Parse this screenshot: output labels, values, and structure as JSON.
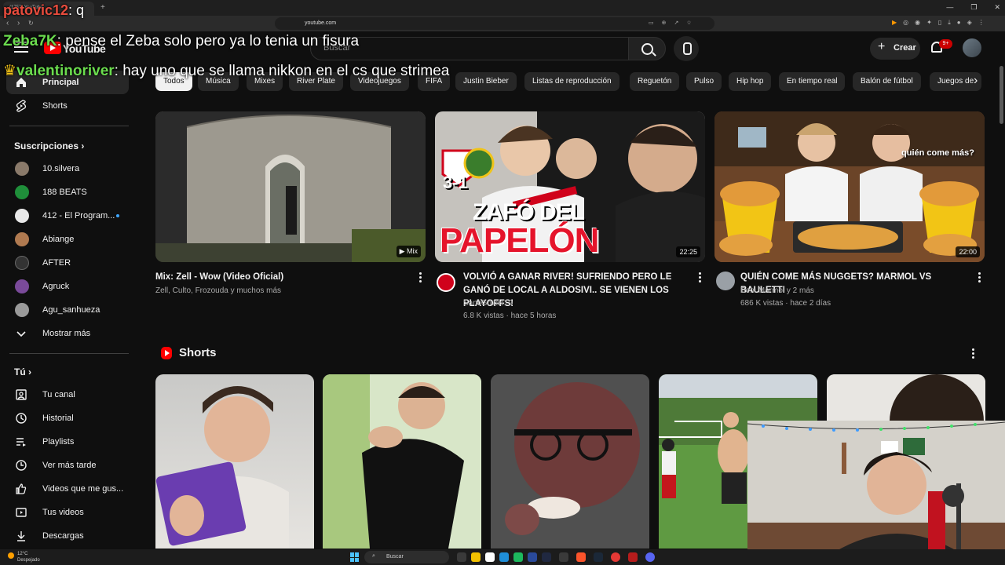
{
  "browser": {
    "tab_title": "(1757) YouTube",
    "new_tab": "+",
    "address": "youtube.com",
    "win_controls": [
      "—",
      "❐",
      "✕"
    ]
  },
  "yt": {
    "wordmark": "YouTube",
    "search_placeholder": "Buscar",
    "create_label": "Crear",
    "notif_count": "9+"
  },
  "chat": [
    {
      "user": "patovic12",
      "text": ": q",
      "color": "#e84c3d"
    },
    {
      "user": "Zeba7K",
      "text": ": pense el Zeba solo pero ya lo tenia un fisura",
      "color": "#6bdc4e"
    },
    {
      "user": "valentinoriver",
      "text": ": hay uno que se llama nikkon en el cs que strimea",
      "color": "#6bdc4e"
    }
  ],
  "sidebar": {
    "main": [
      {
        "label": "Principal",
        "icon": "home-icon",
        "active": true
      },
      {
        "label": "Shorts",
        "icon": "shorts-icon",
        "active": false
      }
    ],
    "subs_header": "Suscripciones",
    "subs": [
      {
        "label": "10.silvera",
        "color": "#8a7a6a"
      },
      {
        "label": "188 BEATS",
        "color": "#1f8f3a"
      },
      {
        "label": "412 - El Program...",
        "color": "#e8e8e8",
        "live": true
      },
      {
        "label": "Abiange",
        "color": "#b07a50"
      },
      {
        "label": "AFTER",
        "color": "#333333"
      },
      {
        "label": "Agruck",
        "color": "#7a4a9a"
      },
      {
        "label": "Agu_sanhueza",
        "color": "#9a9a9a"
      }
    ],
    "show_more": "Mostrar más",
    "you_header": "Tú",
    "you": [
      {
        "label": "Tu canal",
        "icon": "channel-icon"
      },
      {
        "label": "Historial",
        "icon": "history-icon"
      },
      {
        "label": "Playlists",
        "icon": "playlists-icon"
      },
      {
        "label": "Ver más tarde",
        "icon": "watch-later-icon"
      },
      {
        "label": "Videos que me gus...",
        "icon": "like-icon"
      },
      {
        "label": "Tus videos",
        "icon": "your-videos-icon"
      },
      {
        "label": "Descargas",
        "icon": "download-icon"
      }
    ]
  },
  "chips": [
    "Todos",
    "Música",
    "Mixes",
    "River Plate",
    "Videojuegos",
    "FIFA",
    "Justin Bieber",
    "Listas de reproducción",
    "Reguetón",
    "Pulso",
    "Hip hop",
    "En tiempo real",
    "Balón de fútbol",
    "Juegos de"
  ],
  "videos": [
    {
      "title": "Mix: Zell - Wow (Video Oficial)",
      "channel": "Zell, Culto, Frozouda y muchos más",
      "stats": "",
      "badge": "Mix"
    },
    {
      "title": "VOLVIÓ A GANAR RIVER! SUFRIENDO PERO LE GANÓ DE LOCAL A ALDOSIVI.. SE VIENEN LOS PLAYOFFS!",
      "channel": "SantiGrizas19",
      "stats": "6.8 K vistas · hace 5 horas",
      "badge": "22:25",
      "thumb_text": [
        "3-1",
        "ZAFÓ DEL",
        "PAPELÓN"
      ]
    },
    {
      "title": "QUIÉN COME MÁS NUGGETS? MARMOL VS BAULETTI",
      "channel": "Beni Marmol y 2 más",
      "stats": "686 K vistas · hace 2 días",
      "badge": "22:00",
      "thumb_text": [
        "quién come más?"
      ]
    }
  ],
  "shorts_title": "Shorts",
  "taskbar": {
    "weather_temp": "12°C",
    "weather_desc": "Despejado",
    "search": "Buscar"
  }
}
